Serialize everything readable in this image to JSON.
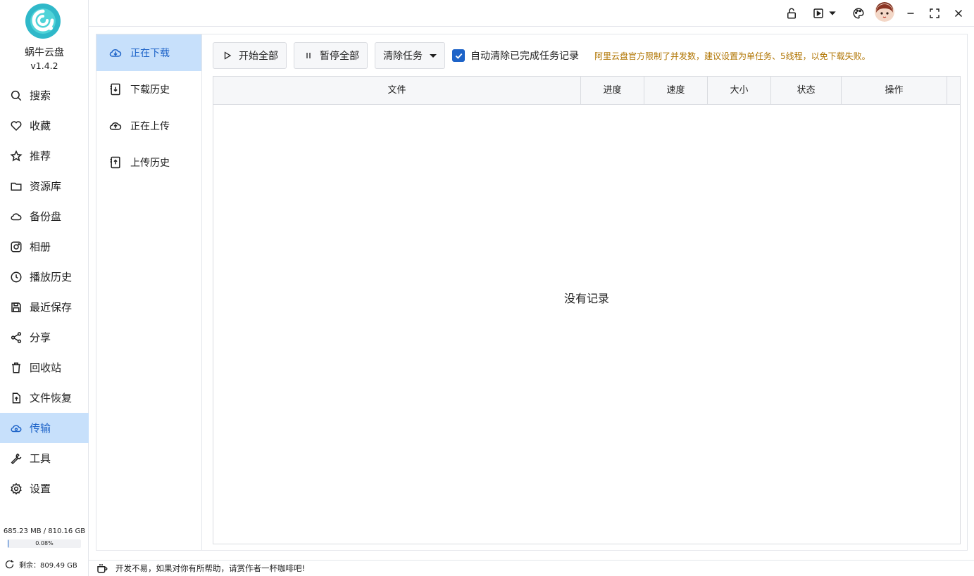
{
  "app": {
    "name": "蜗牛云盘",
    "version": "v1.4.2"
  },
  "sidebar": {
    "items": [
      {
        "label": "搜索",
        "icon": "search-icon"
      },
      {
        "label": "收藏",
        "icon": "heart-icon"
      },
      {
        "label": "推荐",
        "icon": "star-icon"
      },
      {
        "label": "资源库",
        "icon": "folder-icon"
      },
      {
        "label": "备份盘",
        "icon": "cloud-icon"
      },
      {
        "label": "相册",
        "icon": "photo-icon"
      },
      {
        "label": "播放历史",
        "icon": "clock-icon"
      },
      {
        "label": "最近保存",
        "icon": "save-icon"
      },
      {
        "label": "分享",
        "icon": "share-icon"
      },
      {
        "label": "回收站",
        "icon": "trash-icon"
      },
      {
        "label": "文件恢复",
        "icon": "file-restore-icon"
      },
      {
        "label": "传输",
        "icon": "transfer-cloud-icon",
        "active": true
      },
      {
        "label": "工具",
        "icon": "wrench-icon"
      },
      {
        "label": "设置",
        "icon": "gear-icon"
      }
    ],
    "storage": {
      "used_text": "685.23 MB / 810.16 GB",
      "percent_text": "0.08%",
      "percent": 0.08,
      "remaining": "剩余：809.49 GB"
    }
  },
  "transfer_nav": {
    "items": [
      {
        "label": "正在下载",
        "icon": "cloud-download-icon",
        "active": true
      },
      {
        "label": "下载历史",
        "icon": "download-history-icon"
      },
      {
        "label": "正在上传",
        "icon": "cloud-upload-icon"
      },
      {
        "label": "上传历史",
        "icon": "upload-history-icon"
      }
    ]
  },
  "toolbar": {
    "start_all": "开始全部",
    "pause_all": "暂停全部",
    "clear_tasks": "清除任务",
    "auto_clear_label": "自动清除已完成任务记录",
    "auto_clear_checked": true,
    "warning": "阿里云盘官方限制了并发数，建议设置为单任务、5线程，以免下载失败。"
  },
  "table": {
    "columns": [
      "文件",
      "进度",
      "速度",
      "大小",
      "状态",
      "操作"
    ],
    "empty_text": "没有记录"
  },
  "footer": {
    "message": "开发不易，如果对你有所帮助，请赏作者一杯咖啡吧!"
  },
  "colors": {
    "accent": "#1d63c8",
    "active_bg": "#c7e0fb",
    "warning": "#b07400"
  }
}
